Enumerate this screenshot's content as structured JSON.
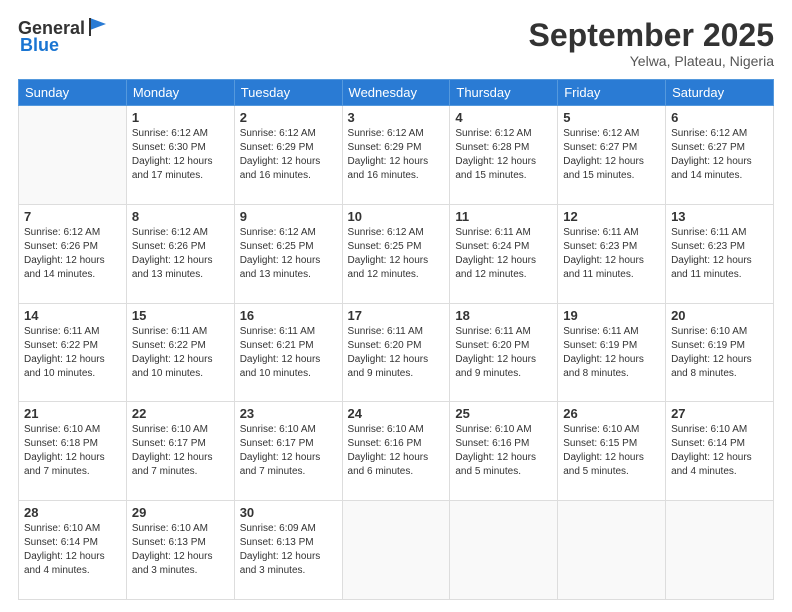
{
  "header": {
    "logo_general": "General",
    "logo_blue": "Blue",
    "month": "September 2025",
    "location": "Yelwa, Plateau, Nigeria"
  },
  "weekdays": [
    "Sunday",
    "Monday",
    "Tuesday",
    "Wednesday",
    "Thursday",
    "Friday",
    "Saturday"
  ],
  "weeks": [
    [
      {
        "day": "",
        "info": ""
      },
      {
        "day": "1",
        "info": "Sunrise: 6:12 AM\nSunset: 6:30 PM\nDaylight: 12 hours\nand 17 minutes."
      },
      {
        "day": "2",
        "info": "Sunrise: 6:12 AM\nSunset: 6:29 PM\nDaylight: 12 hours\nand 16 minutes."
      },
      {
        "day": "3",
        "info": "Sunrise: 6:12 AM\nSunset: 6:29 PM\nDaylight: 12 hours\nand 16 minutes."
      },
      {
        "day": "4",
        "info": "Sunrise: 6:12 AM\nSunset: 6:28 PM\nDaylight: 12 hours\nand 15 minutes."
      },
      {
        "day": "5",
        "info": "Sunrise: 6:12 AM\nSunset: 6:27 PM\nDaylight: 12 hours\nand 15 minutes."
      },
      {
        "day": "6",
        "info": "Sunrise: 6:12 AM\nSunset: 6:27 PM\nDaylight: 12 hours\nand 14 minutes."
      }
    ],
    [
      {
        "day": "7",
        "info": "Sunrise: 6:12 AM\nSunset: 6:26 PM\nDaylight: 12 hours\nand 14 minutes."
      },
      {
        "day": "8",
        "info": "Sunrise: 6:12 AM\nSunset: 6:26 PM\nDaylight: 12 hours\nand 13 minutes."
      },
      {
        "day": "9",
        "info": "Sunrise: 6:12 AM\nSunset: 6:25 PM\nDaylight: 12 hours\nand 13 minutes."
      },
      {
        "day": "10",
        "info": "Sunrise: 6:12 AM\nSunset: 6:25 PM\nDaylight: 12 hours\nand 12 minutes."
      },
      {
        "day": "11",
        "info": "Sunrise: 6:11 AM\nSunset: 6:24 PM\nDaylight: 12 hours\nand 12 minutes."
      },
      {
        "day": "12",
        "info": "Sunrise: 6:11 AM\nSunset: 6:23 PM\nDaylight: 12 hours\nand 11 minutes."
      },
      {
        "day": "13",
        "info": "Sunrise: 6:11 AM\nSunset: 6:23 PM\nDaylight: 12 hours\nand 11 minutes."
      }
    ],
    [
      {
        "day": "14",
        "info": "Sunrise: 6:11 AM\nSunset: 6:22 PM\nDaylight: 12 hours\nand 10 minutes."
      },
      {
        "day": "15",
        "info": "Sunrise: 6:11 AM\nSunset: 6:22 PM\nDaylight: 12 hours\nand 10 minutes."
      },
      {
        "day": "16",
        "info": "Sunrise: 6:11 AM\nSunset: 6:21 PM\nDaylight: 12 hours\nand 10 minutes."
      },
      {
        "day": "17",
        "info": "Sunrise: 6:11 AM\nSunset: 6:20 PM\nDaylight: 12 hours\nand 9 minutes."
      },
      {
        "day": "18",
        "info": "Sunrise: 6:11 AM\nSunset: 6:20 PM\nDaylight: 12 hours\nand 9 minutes."
      },
      {
        "day": "19",
        "info": "Sunrise: 6:11 AM\nSunset: 6:19 PM\nDaylight: 12 hours\nand 8 minutes."
      },
      {
        "day": "20",
        "info": "Sunrise: 6:10 AM\nSunset: 6:19 PM\nDaylight: 12 hours\nand 8 minutes."
      }
    ],
    [
      {
        "day": "21",
        "info": "Sunrise: 6:10 AM\nSunset: 6:18 PM\nDaylight: 12 hours\nand 7 minutes."
      },
      {
        "day": "22",
        "info": "Sunrise: 6:10 AM\nSunset: 6:17 PM\nDaylight: 12 hours\nand 7 minutes."
      },
      {
        "day": "23",
        "info": "Sunrise: 6:10 AM\nSunset: 6:17 PM\nDaylight: 12 hours\nand 7 minutes."
      },
      {
        "day": "24",
        "info": "Sunrise: 6:10 AM\nSunset: 6:16 PM\nDaylight: 12 hours\nand 6 minutes."
      },
      {
        "day": "25",
        "info": "Sunrise: 6:10 AM\nSunset: 6:16 PM\nDaylight: 12 hours\nand 5 minutes."
      },
      {
        "day": "26",
        "info": "Sunrise: 6:10 AM\nSunset: 6:15 PM\nDaylight: 12 hours\nand 5 minutes."
      },
      {
        "day": "27",
        "info": "Sunrise: 6:10 AM\nSunset: 6:14 PM\nDaylight: 12 hours\nand 4 minutes."
      }
    ],
    [
      {
        "day": "28",
        "info": "Sunrise: 6:10 AM\nSunset: 6:14 PM\nDaylight: 12 hours\nand 4 minutes."
      },
      {
        "day": "29",
        "info": "Sunrise: 6:10 AM\nSunset: 6:13 PM\nDaylight: 12 hours\nand 3 minutes."
      },
      {
        "day": "30",
        "info": "Sunrise: 6:09 AM\nSunset: 6:13 PM\nDaylight: 12 hours\nand 3 minutes."
      },
      {
        "day": "",
        "info": ""
      },
      {
        "day": "",
        "info": ""
      },
      {
        "day": "",
        "info": ""
      },
      {
        "day": "",
        "info": ""
      }
    ]
  ]
}
